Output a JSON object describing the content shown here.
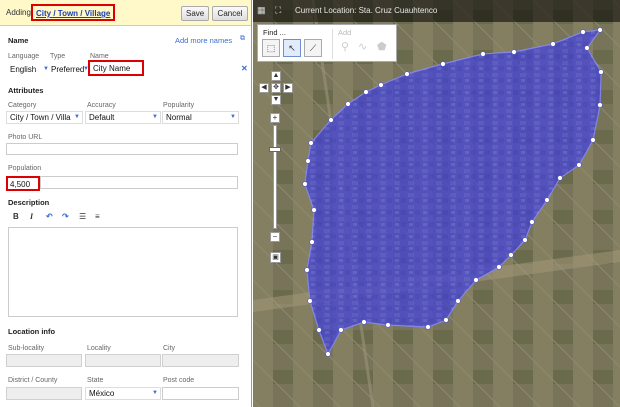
{
  "topbar": {
    "adding_label": "Adding",
    "feature_type_link": "City / Town / Village",
    "save_label": "Save",
    "cancel_label": "Cancel"
  },
  "name_section": {
    "title": "Name",
    "add_more_label": "Add more names",
    "language_label": "Language",
    "type_label": "Type",
    "name_label": "Name",
    "language_value": "English",
    "type_value": "Preferred",
    "name_value": "City Name"
  },
  "attributes": {
    "title": "Attributes",
    "category_label": "Category",
    "category_value": "City / Town / Villa",
    "accuracy_label": "Accuracy",
    "accuracy_value": "Default",
    "popularity_label": "Popularity",
    "popularity_value": "Normal",
    "photo_url_label": "Photo URL",
    "photo_url_value": "",
    "population_label": "Population",
    "population_value": "4,500"
  },
  "description": {
    "title": "Description",
    "toolbar": [
      "B",
      "I",
      "↶",
      "↷",
      "☰",
      "≡"
    ],
    "value": ""
  },
  "location_info": {
    "title": "Location info",
    "sublocality_label": "Sub-locality",
    "locality_label": "Locality",
    "city_label": "City",
    "district_label": "District / County",
    "state_label": "State",
    "state_value": "México",
    "postcode_label": "Post code"
  },
  "map": {
    "current_location_text": "Current Location:  Sta. Cruz Cuauhtenco",
    "find_label": "Find ...",
    "add_label": "Add",
    "polygon_fill": "#3c3ccf",
    "polygon_stroke": "#8a8cf0",
    "vertex_color": "#ffffff",
    "zoom_level_fraction": 0.78
  },
  "colors": {
    "highlight_red": "#dd0000",
    "link_blue": "#1a3fb0",
    "topbar_yellow": "#fff8c8"
  }
}
